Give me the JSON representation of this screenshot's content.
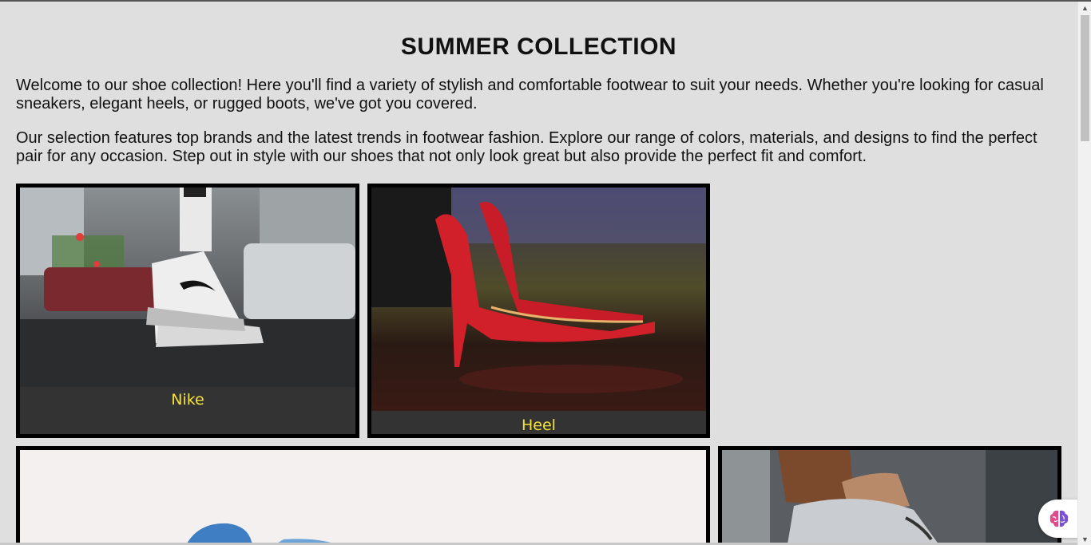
{
  "page": {
    "title": "SUMMER COLLECTION",
    "paragraphs": [
      "Welcome to our shoe collection! Here you'll find a variety of stylish and comfortable footwear to suit your needs. Whether you're looking for casual sneakers, elegant heels, or rugged boots, we've got you covered.",
      "Our selection features top brands and the latest trends in footwear fashion. Explore our range of colors, materials, and designs to find the perfect pair for any occasion. Step out in style with our shoes that not only look great but also provide the perfect fit and comfort."
    ]
  },
  "products": [
    {
      "caption": "Nike",
      "image": "nike-sneaker-photo"
    },
    {
      "caption": "Heel",
      "image": "red-heels-photo"
    },
    {
      "caption": "",
      "image": "blue-shoe-photo"
    },
    {
      "caption": "",
      "image": "grey-sneaker-photo"
    }
  ],
  "colors": {
    "background": "#dfdfdf",
    "card_border": "#000000",
    "caption_bg": "#333333",
    "caption_text": "#f5e23a"
  },
  "widget": {
    "icon": "brain-icon"
  }
}
